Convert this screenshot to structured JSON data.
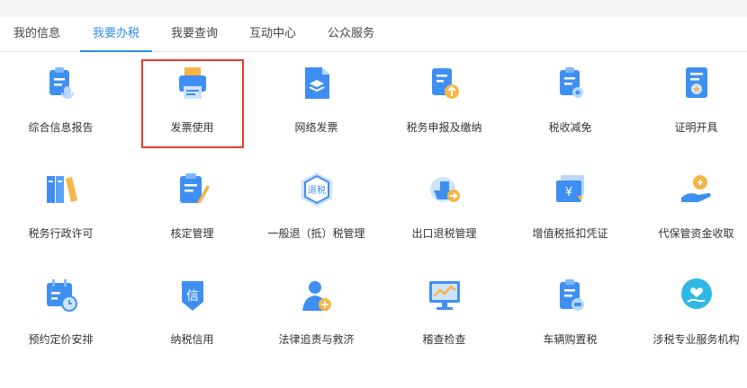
{
  "tabs": [
    {
      "label": "我的信息"
    },
    {
      "label": "我要办税"
    },
    {
      "label": "我要查询"
    },
    {
      "label": "互动中心"
    },
    {
      "label": "公众服务"
    }
  ],
  "active_tab": "我要办税",
  "accent_color": "#2d8cf0",
  "highlight_color": "#e8392f",
  "items": [
    {
      "label": "综合信息报告",
      "icon": "clipboard-mic-icon"
    },
    {
      "label": "发票使用",
      "icon": "printer-icon"
    },
    {
      "label": "网络发票",
      "icon": "document-layers-icon"
    },
    {
      "label": "税务申报及缴纳",
      "icon": "document-upload-icon"
    },
    {
      "label": "税收减免",
      "icon": "clipboard-coin-icon"
    },
    {
      "label": "证明开具",
      "icon": "certificate-icon"
    },
    {
      "label": "税务行政许可",
      "icon": "binders-icon"
    },
    {
      "label": "核定管理",
      "icon": "clipboard-pen-icon"
    },
    {
      "label": "一般退（抵）税管理",
      "icon": "refund-hexagon-icon"
    },
    {
      "label": "出口退税管理",
      "icon": "ship-refund-icon"
    },
    {
      "label": "增值税抵扣凭证",
      "icon": "yuan-voucher-icon"
    },
    {
      "label": "代保管资金收取",
      "icon": "hand-money-icon"
    },
    {
      "label": "预约定价安排",
      "icon": "calendar-clock-icon"
    },
    {
      "label": "纳税信用",
      "icon": "credit-shield-icon"
    },
    {
      "label": "法律追责与救济",
      "icon": "lawyer-scale-icon"
    },
    {
      "label": "稽查检查",
      "icon": "monitor-chart-icon"
    },
    {
      "label": "车辆购置税",
      "icon": "clipboard-car-icon"
    },
    {
      "label": "涉税专业服务机构",
      "icon": "heart-hand-icon"
    }
  ],
  "icon_glyphs": {
    "refund": "退税",
    "credit": "信",
    "yuan": "¥"
  }
}
